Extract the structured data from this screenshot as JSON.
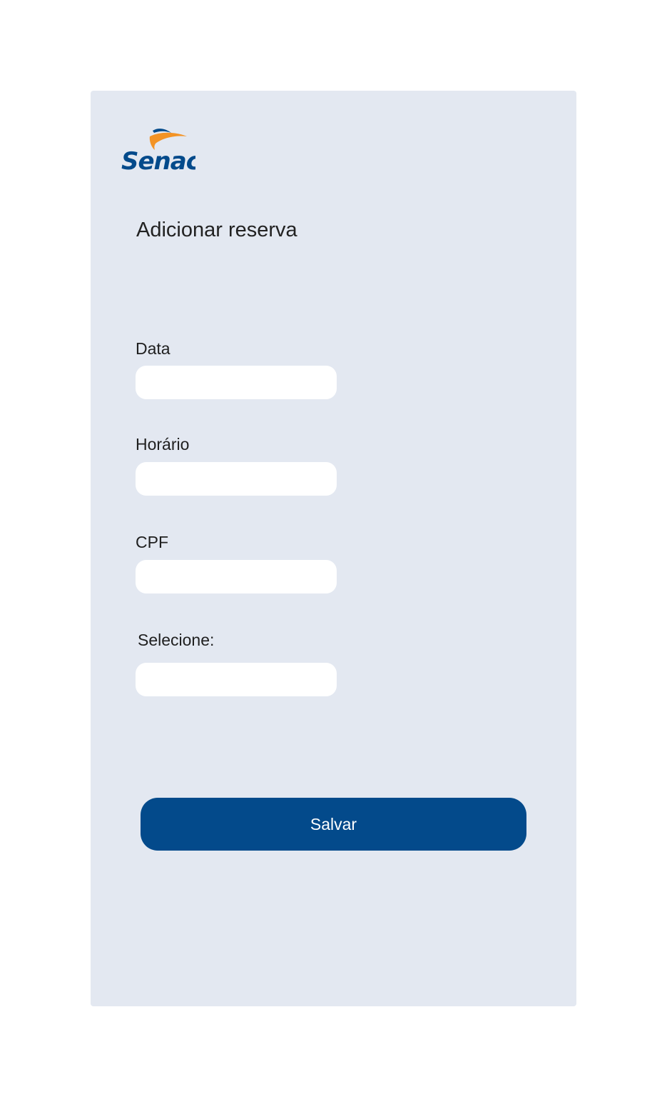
{
  "brand": {
    "logo_text": "Senac",
    "color_primary": "#034a8b",
    "color_accent": "#f39325"
  },
  "page": {
    "title": "Adicionar reserva"
  },
  "form": {
    "fields": [
      {
        "label": "Data",
        "value": "",
        "placeholder": ""
      },
      {
        "label": "Horário",
        "value": "",
        "placeholder": ""
      },
      {
        "label": "CPF",
        "value": "",
        "placeholder": ""
      },
      {
        "label": "Selecione:",
        "value": "",
        "placeholder": ""
      }
    ],
    "save_label": "Salvar"
  },
  "colors": {
    "card_background": "#e3e8f1",
    "page_background": "#ffffff",
    "input_background": "#ffffff"
  }
}
